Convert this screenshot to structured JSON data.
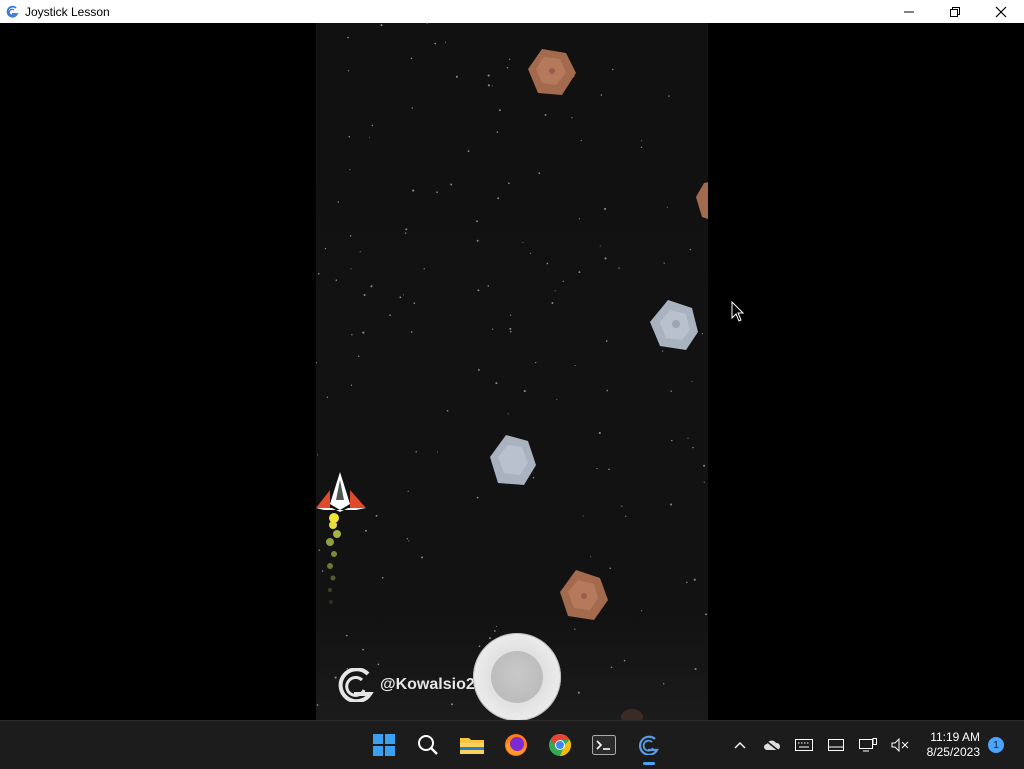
{
  "window": {
    "title": "Joystick Lesson"
  },
  "game": {
    "watermark": "@Kowalsio212",
    "asteroid_colors": {
      "brown": "#a46a4e",
      "gray": "#a9b3bf"
    }
  },
  "taskbar": {
    "apps": [
      {
        "name": "start-icon"
      },
      {
        "name": "search-icon"
      },
      {
        "name": "file-explorer-icon"
      },
      {
        "name": "firefox-icon"
      },
      {
        "name": "chrome-icon"
      },
      {
        "name": "terminal-icon"
      },
      {
        "name": "gdevelop-icon",
        "active": true
      }
    ],
    "clock": {
      "time": "11:19 AM",
      "date": "8/25/2023"
    },
    "notification_count": "1"
  },
  "colors": {
    "accent": "#4aa3ff",
    "taskbar": "#1c1c1c",
    "titlebar": "#ffffff"
  }
}
